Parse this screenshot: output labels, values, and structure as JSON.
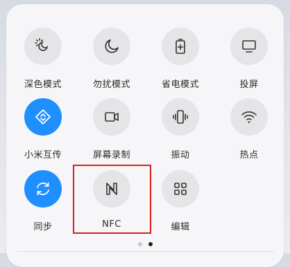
{
  "tiles": [
    {
      "label": "深色模式",
      "icon": "dark-mode-icon",
      "active": false
    },
    {
      "label": "勿扰模式",
      "icon": "moon-icon",
      "active": false
    },
    {
      "label": "省电模式",
      "icon": "battery-saver-icon",
      "active": false
    },
    {
      "label": "投屏",
      "icon": "screen-cast-icon",
      "active": false
    },
    {
      "label": "小米互传",
      "icon": "mi-share-icon",
      "active": true
    },
    {
      "label": "屏幕录制",
      "icon": "screen-record-icon",
      "active": false
    },
    {
      "label": "振动",
      "icon": "vibrate-icon",
      "active": false
    },
    {
      "label": "热点",
      "icon": "hotspot-icon",
      "active": false
    },
    {
      "label": "同步",
      "icon": "sync-icon",
      "active": true
    },
    {
      "label": "NFC",
      "icon": "nfc-icon",
      "active": false
    },
    {
      "label": "编辑",
      "icon": "edit-grid-icon",
      "active": false
    }
  ],
  "pagination": {
    "pages": 2,
    "current": 2
  },
  "colors": {
    "active": "#1f8fff",
    "inactive": "#e5e5e8",
    "highlight": "#d81f1f"
  }
}
